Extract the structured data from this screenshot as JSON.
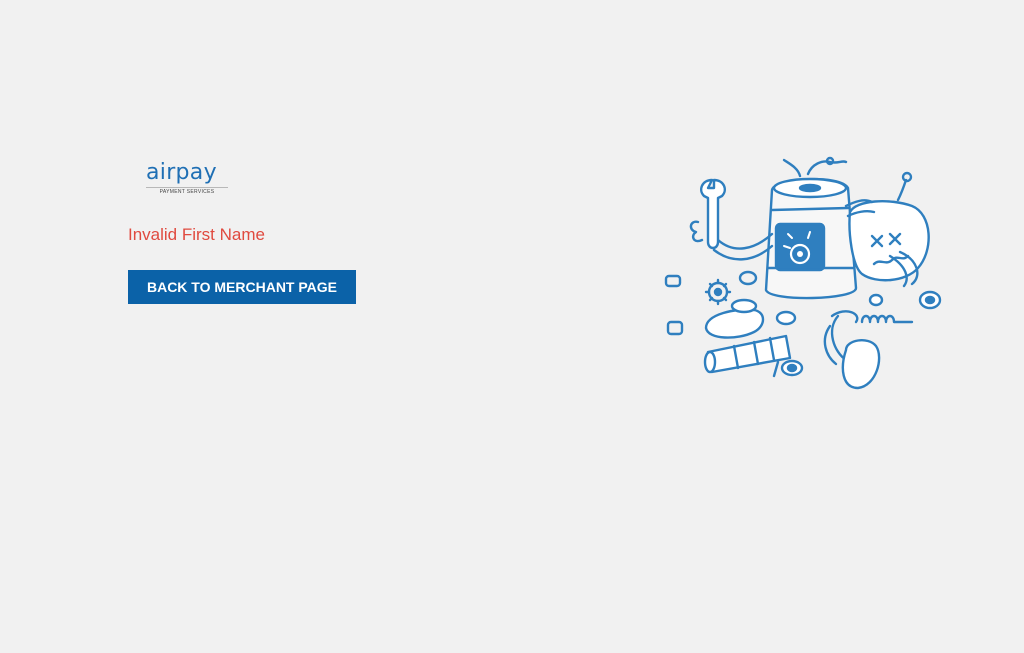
{
  "logo": {
    "wordmark": "airpay",
    "tagline": "PAYMENT SERVICES",
    "color": "#1f6fb4"
  },
  "error": {
    "message": "Invalid First Name",
    "color": "#e04a3f"
  },
  "actions": {
    "back_label": "BACK TO MERCHANT PAGE",
    "color": "#0b62a8"
  },
  "illustration": {
    "icon": "broken-robot-icon",
    "stroke_color": "#2f7fbf"
  }
}
